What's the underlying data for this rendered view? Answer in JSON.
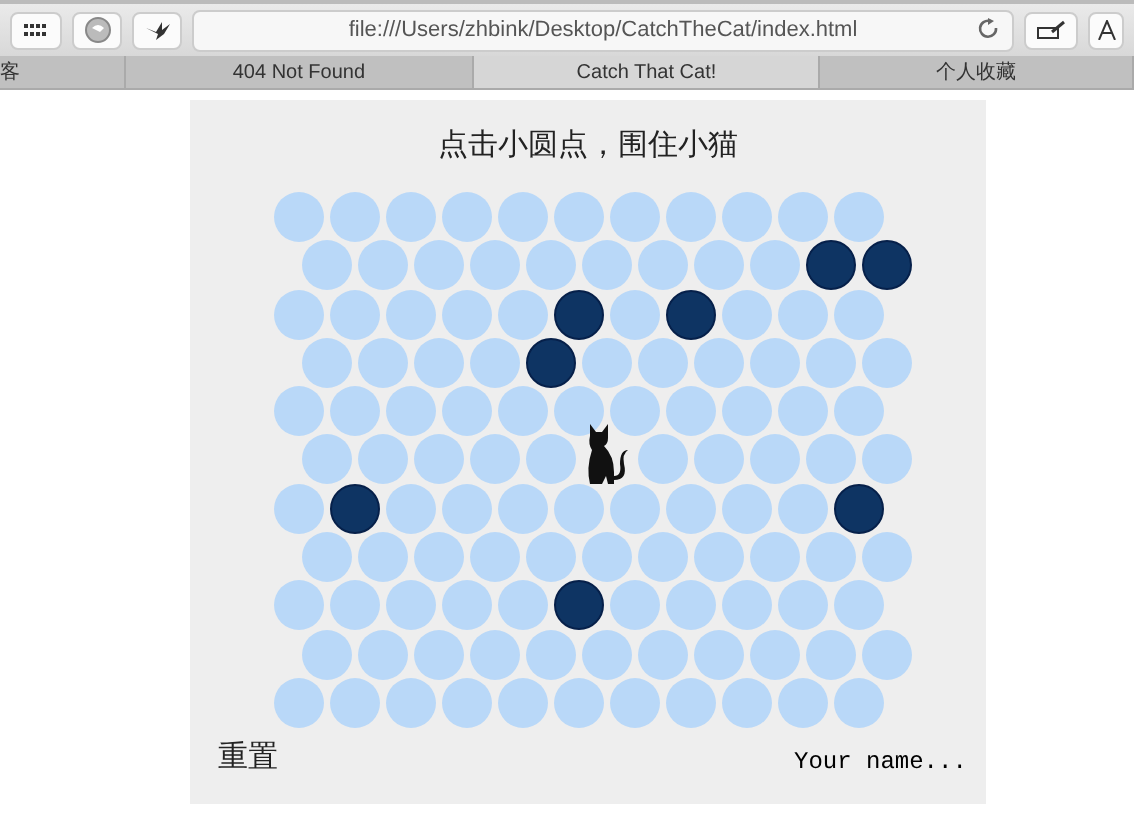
{
  "browser": {
    "url": "file:///Users/zhbink/Desktop/CatchTheCat/index.html"
  },
  "tabs": [
    {
      "label": "客",
      "selected": false
    },
    {
      "label": "404 Not Found",
      "selected": false
    },
    {
      "label": "Catch That Cat!",
      "selected": true
    },
    {
      "label": "个人收藏",
      "selected": false
    }
  ],
  "game": {
    "title": "点击小圆点，围住小猫",
    "grid": [
      [
        {
          "kind": "dot"
        },
        {
          "kind": "dot"
        },
        {
          "kind": "dot"
        },
        {
          "kind": "dot"
        },
        {
          "kind": "dot"
        },
        {
          "kind": "dot"
        },
        {
          "kind": "dot"
        },
        {
          "kind": "dot"
        },
        {
          "kind": "dot"
        },
        {
          "kind": "dot"
        },
        {
          "kind": "dot"
        }
      ],
      [
        {
          "kind": "dot"
        },
        {
          "kind": "dot"
        },
        {
          "kind": "dot"
        },
        {
          "kind": "dot"
        },
        {
          "kind": "dot"
        },
        {
          "kind": "dot"
        },
        {
          "kind": "dot"
        },
        {
          "kind": "dot"
        },
        {
          "kind": "dot"
        },
        {
          "kind": "wall"
        },
        {
          "kind": "wall"
        }
      ],
      [
        {
          "kind": "dot"
        },
        {
          "kind": "dot"
        },
        {
          "kind": "dot"
        },
        {
          "kind": "dot"
        },
        {
          "kind": "dot"
        },
        {
          "kind": "wall"
        },
        {
          "kind": "dot"
        },
        {
          "kind": "wall"
        },
        {
          "kind": "dot"
        },
        {
          "kind": "dot"
        },
        {
          "kind": "dot"
        }
      ],
      [
        {
          "kind": "dot"
        },
        {
          "kind": "dot"
        },
        {
          "kind": "dot"
        },
        {
          "kind": "dot"
        },
        {
          "kind": "wall"
        },
        {
          "kind": "dot"
        },
        {
          "kind": "dot"
        },
        {
          "kind": "dot"
        },
        {
          "kind": "dot"
        },
        {
          "kind": "dot"
        },
        {
          "kind": "dot"
        }
      ],
      [
        {
          "kind": "dot"
        },
        {
          "kind": "dot"
        },
        {
          "kind": "dot"
        },
        {
          "kind": "dot"
        },
        {
          "kind": "dot"
        },
        {
          "kind": "dot"
        },
        {
          "kind": "dot"
        },
        {
          "kind": "dot"
        },
        {
          "kind": "dot"
        },
        {
          "kind": "dot"
        },
        {
          "kind": "dot"
        }
      ],
      [
        {
          "kind": "dot"
        },
        {
          "kind": "dot"
        },
        {
          "kind": "dot"
        },
        {
          "kind": "dot"
        },
        {
          "kind": "dot"
        },
        {
          "kind": "cat"
        },
        {
          "kind": "dot"
        },
        {
          "kind": "dot"
        },
        {
          "kind": "dot"
        },
        {
          "kind": "dot"
        },
        {
          "kind": "dot"
        }
      ],
      [
        {
          "kind": "dot"
        },
        {
          "kind": "wall"
        },
        {
          "kind": "dot"
        },
        {
          "kind": "dot"
        },
        {
          "kind": "dot"
        },
        {
          "kind": "dot"
        },
        {
          "kind": "dot"
        },
        {
          "kind": "dot"
        },
        {
          "kind": "dot"
        },
        {
          "kind": "dot"
        },
        {
          "kind": "wall"
        }
      ],
      [
        {
          "kind": "dot"
        },
        {
          "kind": "dot"
        },
        {
          "kind": "dot"
        },
        {
          "kind": "dot"
        },
        {
          "kind": "dot"
        },
        {
          "kind": "dot"
        },
        {
          "kind": "dot"
        },
        {
          "kind": "dot"
        },
        {
          "kind": "dot"
        },
        {
          "kind": "dot"
        },
        {
          "kind": "dot"
        }
      ],
      [
        {
          "kind": "dot"
        },
        {
          "kind": "dot"
        },
        {
          "kind": "dot"
        },
        {
          "kind": "dot"
        },
        {
          "kind": "dot"
        },
        {
          "kind": "wall"
        },
        {
          "kind": "dot"
        },
        {
          "kind": "dot"
        },
        {
          "kind": "dot"
        },
        {
          "kind": "dot"
        },
        {
          "kind": "dot"
        }
      ],
      [
        {
          "kind": "dot"
        },
        {
          "kind": "dot"
        },
        {
          "kind": "dot"
        },
        {
          "kind": "dot"
        },
        {
          "kind": "dot"
        },
        {
          "kind": "dot"
        },
        {
          "kind": "dot"
        },
        {
          "kind": "dot"
        },
        {
          "kind": "dot"
        },
        {
          "kind": "dot"
        },
        {
          "kind": "dot"
        }
      ],
      [
        {
          "kind": "dot"
        },
        {
          "kind": "dot"
        },
        {
          "kind": "dot"
        },
        {
          "kind": "dot"
        },
        {
          "kind": "dot"
        },
        {
          "kind": "dot"
        },
        {
          "kind": "dot"
        },
        {
          "kind": "dot"
        },
        {
          "kind": "dot"
        },
        {
          "kind": "dot"
        },
        {
          "kind": "dot"
        }
      ]
    ],
    "reset_button": "重置",
    "name_field": {
      "placeholder": "Your name..."
    }
  }
}
